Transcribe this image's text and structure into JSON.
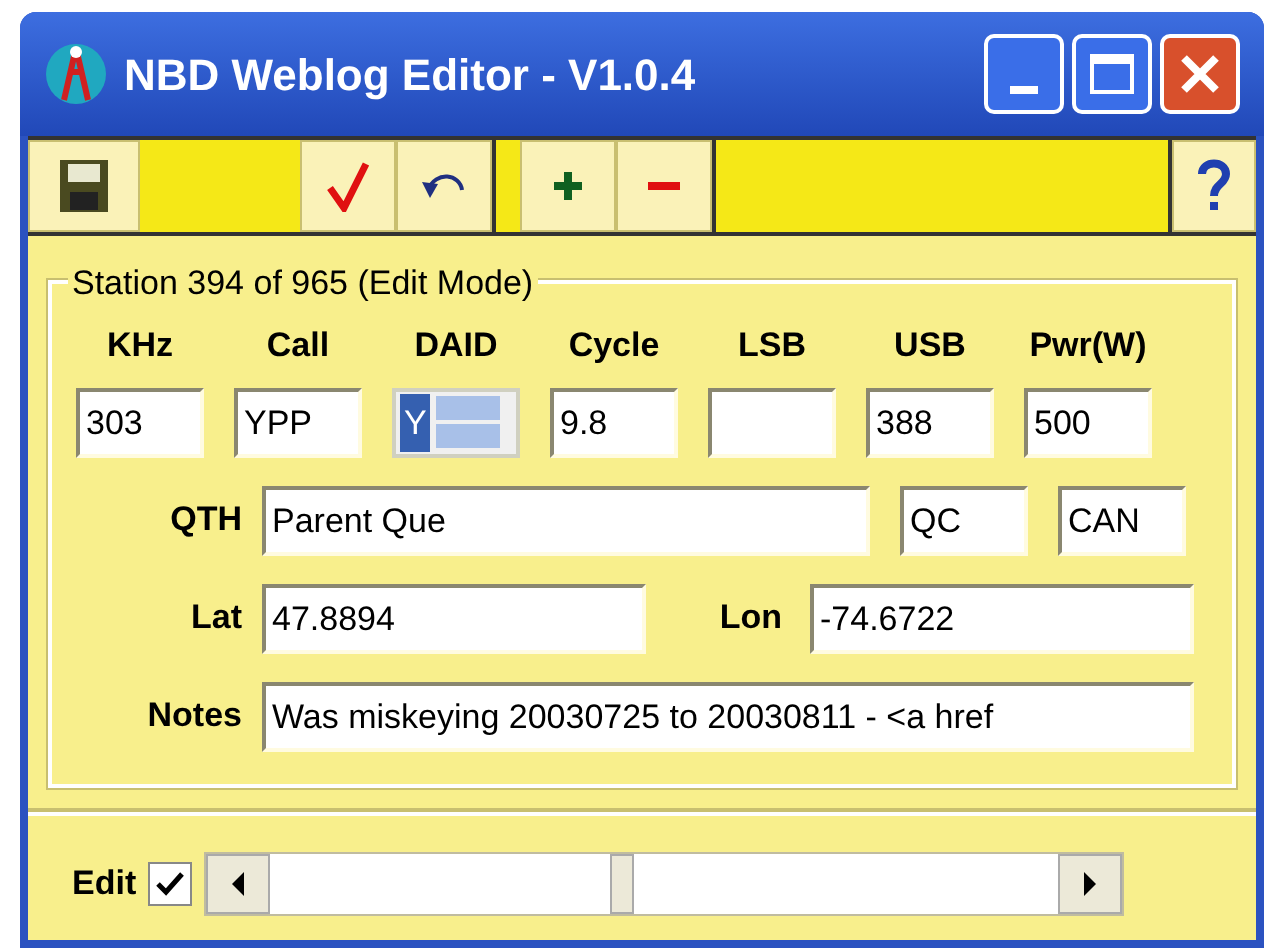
{
  "window": {
    "title": "NBD Weblog Editor - V1.0.4"
  },
  "group": {
    "title": "Station 394 of 965 (Edit Mode)",
    "columns": [
      {
        "label": "KHz",
        "value": "303",
        "kind": "text"
      },
      {
        "label": "Call",
        "value": "YPP",
        "kind": "text"
      },
      {
        "label": "DAID",
        "value": "Y",
        "kind": "spinner"
      },
      {
        "label": "Cycle",
        "value": "9.8",
        "kind": "text"
      },
      {
        "label": "LSB",
        "kind": "text"
      },
      {
        "label": "USB",
        "value": "388",
        "kind": "text"
      },
      {
        "label": "Pwr(W)",
        "value": "500",
        "kind": "text"
      }
    ],
    "qth": {
      "label": "QTH",
      "value": "Parent Que",
      "state": "QC",
      "country": "CAN"
    },
    "lat": {
      "label": "Lat",
      "value": "47.8894"
    },
    "lon": {
      "label": "Lon",
      "value": "-74.6722"
    },
    "notes": {
      "label": "Notes",
      "value": "Was miskeying 20030725 to 20030811 - <a href"
    }
  },
  "edit": {
    "label": "Edit",
    "checked": true
  }
}
